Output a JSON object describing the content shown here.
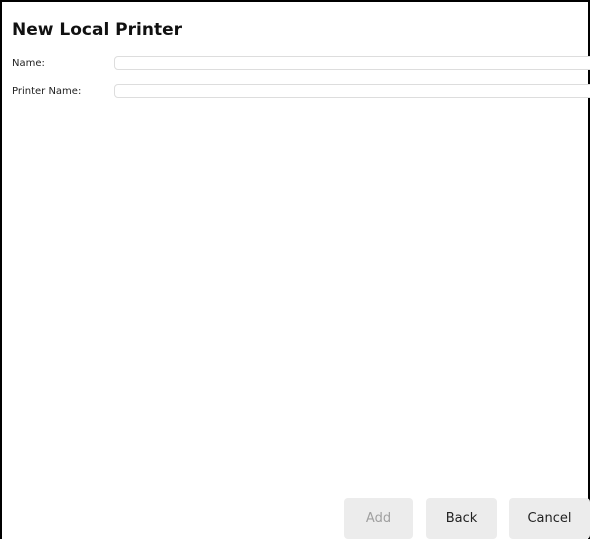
{
  "dialog": {
    "title": "New Local Printer"
  },
  "form": {
    "name_label": "Name:",
    "name_value": "",
    "printer_name_label": "Printer Name:",
    "printer_name_value": ""
  },
  "buttons": {
    "add_label": "Add",
    "add_enabled": false,
    "back_label": "Back",
    "cancel_label": "Cancel"
  }
}
